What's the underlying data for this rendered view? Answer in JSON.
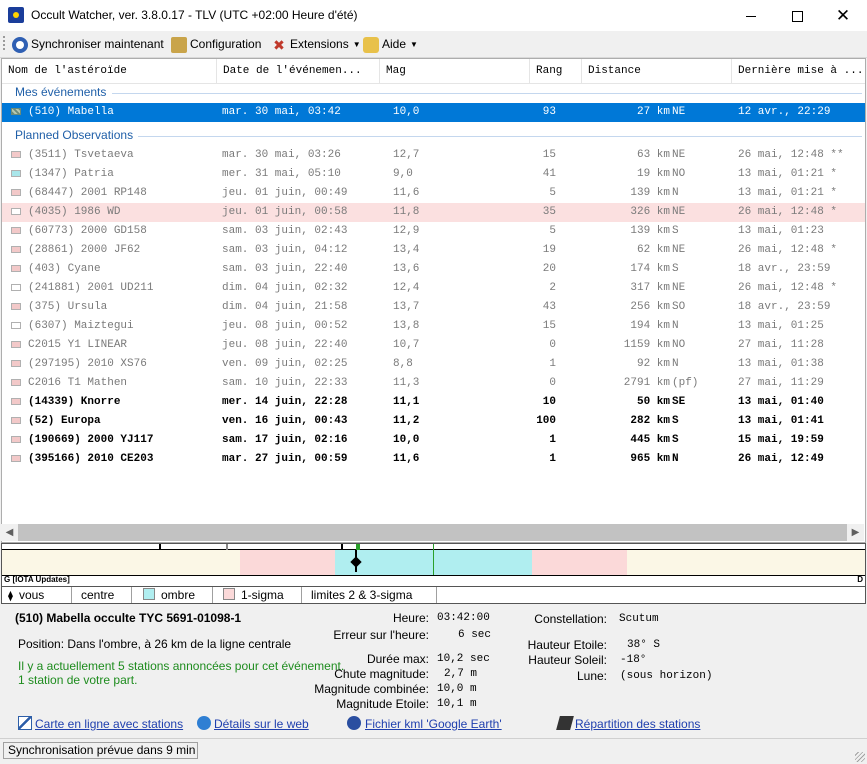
{
  "window": {
    "title": "Occult Watcher, ver. 3.8.0.17 - TLV (UTC +02:00 Heure d'été)",
    "minimize_label": "—",
    "maximize_label": "",
    "close_label": "✕"
  },
  "toolbar": {
    "sync": "Synchroniser maintenant",
    "config": "Configuration",
    "extensions": "Extensions",
    "help": "Aide"
  },
  "columns": [
    "Nom de l'astéroïde",
    "Date de l'événemen...",
    "Mag",
    "Rang",
    "Distance",
    "Dernière mise à ..."
  ],
  "groups": {
    "mine": "Mes événements",
    "planned": "Planned Observations"
  },
  "selected_row": {
    "name": "(510) Mabella",
    "date": "mar. 30 mai, 03:42",
    "mag": "10,0",
    "rang": "93",
    "dist": "27 km",
    "dir": "NE",
    "maj": "12 avr., 22:29"
  },
  "rows": [
    {
      "name": "(3511) Tsvetaeva",
      "date": "mar. 30 mai, 03:26",
      "mag": "12,7",
      "rang": "15",
      "dist": "63 km",
      "dir": "NE",
      "maj": "26 mai, 12:48 **",
      "marker": "#f3c9c9",
      "style": "dim"
    },
    {
      "name": "(1347) Patria",
      "date": "mer. 31 mai, 05:10",
      "mag": "9,0",
      "rang": "41",
      "dist": "19 km",
      "dir": "NO",
      "maj": "13 mai, 01:21 *",
      "marker": "#a9e6ea",
      "style": "dim"
    },
    {
      "name": "(68447) 2001 RP148",
      "date": "jeu. 01 juin, 00:49",
      "mag": "11,6",
      "rang": "5",
      "dist": "139 km",
      "dir": "N",
      "maj": "13 mai, 01:21 *",
      "marker": "#f3c9c9",
      "style": "dim"
    },
    {
      "name": "(4035) 1986 WD",
      "date": "jeu. 01 juin, 00:58",
      "mag": "11,8",
      "rang": "35",
      "dist": "326 km",
      "dir": "NE",
      "maj": "26 mai, 12:48 *",
      "marker": "#ffffff",
      "style": "dim pink"
    },
    {
      "name": "(60773) 2000 GD158",
      "date": "sam. 03 juin, 02:43",
      "mag": "12,9",
      "rang": "5",
      "dist": "139 km",
      "dir": "S",
      "maj": "13 mai, 01:23",
      "marker": "#f3c9c9",
      "style": "dim"
    },
    {
      "name": "(28861) 2000 JF62",
      "date": "sam. 03 juin, 04:12",
      "mag": "13,4",
      "rang": "19",
      "dist": "62 km",
      "dir": "NE",
      "maj": "26 mai, 12:48 *",
      "marker": "#f3c9c9",
      "style": "dim"
    },
    {
      "name": "(403) Cyane",
      "date": "sam. 03 juin, 22:40",
      "mag": "13,6",
      "rang": "20",
      "dist": "174 km",
      "dir": "S",
      "maj": "18 avr., 23:59",
      "marker": "#f3c9c9",
      "style": "dim"
    },
    {
      "name": "(241881) 2001 UD211",
      "date": "dim. 04 juin, 02:32",
      "mag": "12,4",
      "rang": "2",
      "dist": "317 km",
      "dir": "NE",
      "maj": "26 mai, 12:48 *",
      "marker": "#ffffff",
      "style": "dim"
    },
    {
      "name": "(375) Ursula",
      "date": "dim. 04 juin, 21:58",
      "mag": "13,7",
      "rang": "43",
      "dist": "256 km",
      "dir": "SO",
      "maj": "18 avr., 23:59",
      "marker": "#f3c9c9",
      "style": "dim"
    },
    {
      "name": "(6307) Maiztegui",
      "date": "jeu. 08 juin, 00:52",
      "mag": "13,8",
      "rang": "15",
      "dist": "194 km",
      "dir": "N",
      "maj": "13 mai, 01:25",
      "marker": "#ffffff",
      "style": "dim"
    },
    {
      "name": "C2015 Y1 LINEAR",
      "date": "jeu. 08 juin, 22:40",
      "mag": "10,7",
      "rang": "0",
      "dist": "1159 km",
      "dir": "NO",
      "maj": "27 mai, 11:28",
      "marker": "#f3c9c9",
      "style": "dim"
    },
    {
      "name": "(297195) 2010 XS76",
      "date": "ven. 09 juin, 02:25",
      "mag": "8,8",
      "rang": "1",
      "dist": "92 km",
      "dir": "N",
      "maj": "13 mai, 01:38",
      "marker": "#f3c9c9",
      "style": "dim"
    },
    {
      "name": "C2016 T1 Mathen",
      "date": "sam. 10 juin, 22:33",
      "mag": "11,3",
      "rang": "0",
      "dist": "2791 km",
      "dir": "(pf)",
      "maj": "27 mai, 11:29",
      "marker": "#f3c9c9",
      "style": "dim"
    },
    {
      "name": "(14339) Knorre",
      "date": "mer. 14 juin, 22:28",
      "mag": "11,1",
      "rang": "10",
      "dist": "50 km",
      "dir": "SE",
      "maj": "13 mai, 01:40",
      "marker": "#f3c9c9",
      "style": "bold"
    },
    {
      "name": "(52) Europa",
      "date": "ven. 16 juin, 00:43",
      "mag": "11,2",
      "rang": "100",
      "dist": "282 km",
      "dir": "S",
      "maj": "13 mai, 01:41",
      "marker": "#f3c9c9",
      "style": "bold"
    },
    {
      "name": "(190669) 2000 YJ117",
      "date": "sam. 17 juin, 02:16",
      "mag": "10,0",
      "rang": "1",
      "dist": "445 km",
      "dir": "S",
      "maj": "15 mai, 19:59",
      "marker": "#f3c9c9",
      "style": "bold"
    },
    {
      "name": "(395166) 2010 CE203",
      "date": "mar. 27 juin, 00:59",
      "mag": "11,6",
      "rang": "1",
      "dist": "965 km",
      "dir": "N",
      "maj": "26 mai, 12:49",
      "marker": "#f3c9c9",
      "style": "bold"
    }
  ],
  "timeline": {
    "left_label": "G [IOTA Updates]",
    "right_label": "D"
  },
  "legend": {
    "vous": "vous",
    "centre": "centre",
    "ombre": "ombre",
    "sigma1": "1-sigma",
    "limits": "limites 2 & 3-sigma",
    "colors": {
      "ombre": "#b0eef0",
      "sigma1": "#fbd9d9"
    }
  },
  "details": {
    "title": "(510) Mabella occulte TYC 5691-01098-1",
    "position": "Position:   Dans l'ombre, à 26 km de la ligne centrale",
    "stations_line1": "Il y a actuellement 5 stations annoncées pour cet événement.",
    "stations_line2": "1 station de votre part.",
    "heure_label": "Heure:",
    "heure_value": "03:42:00",
    "erreur_label": "Erreur sur l'heure:",
    "erreur_value": "6 sec",
    "duree_label": "Durée max:",
    "duree_value": "10,2 sec",
    "chute_label": "Chute magnitude:",
    "chute_value": "2,7 m",
    "magcomb_label": "Magnitude combinée:",
    "magcomb_value": "10,0 m",
    "magetoile_label": "Magnitude Etoile:",
    "magetoile_value": "10,1 m",
    "constellation_label": "Constellation:",
    "constellation_value": "Scutum",
    "hauteur_etoile_label": "Hauteur Etoile:",
    "hauteur_etoile_value": "38° S",
    "hauteur_soleil_label": "Hauteur Soleil:",
    "hauteur_soleil_value": "-18°",
    "lune_label": "Lune:",
    "lune_value": "(sous horizon)",
    "links": {
      "carte": "Carte en ligne avec stations",
      "web": "Détails sur le web",
      "kml": "Fichier kml 'Google Earth'",
      "repartition": "Répartition des stations"
    }
  },
  "status": {
    "text": "Synchronisation prévue dans 9 min"
  }
}
